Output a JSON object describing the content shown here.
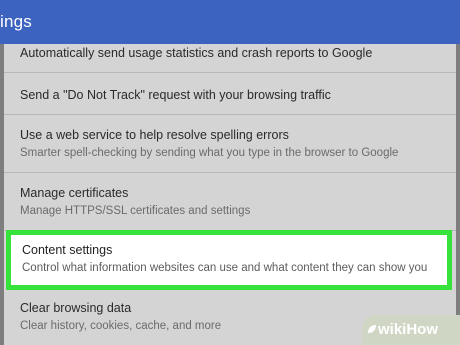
{
  "header": {
    "title": "ings"
  },
  "settings": {
    "items": [
      {
        "title": "Automatically send usage statistics and crash reports to Google"
      },
      {
        "title": "Send a \"Do Not Track\" request with your browsing traffic"
      },
      {
        "title": "Use a web service to help resolve spelling errors",
        "subtitle": "Smarter spell-checking by sending what you type in the browser to Google"
      },
      {
        "title": "Manage certificates",
        "subtitle": "Manage HTTPS/SSL certificates and settings"
      },
      {
        "title": "Content settings",
        "subtitle": "Control what information websites can use and what content they can show you",
        "highlighted": true
      },
      {
        "title": "Clear browsing data",
        "subtitle": "Clear history, cookies, cache, and more"
      }
    ]
  },
  "watermark": {
    "text": "wikiHow"
  },
  "colors": {
    "header": "#3d63c0",
    "panel": "#d4d4d4",
    "highlight_border": "#37e23a"
  }
}
